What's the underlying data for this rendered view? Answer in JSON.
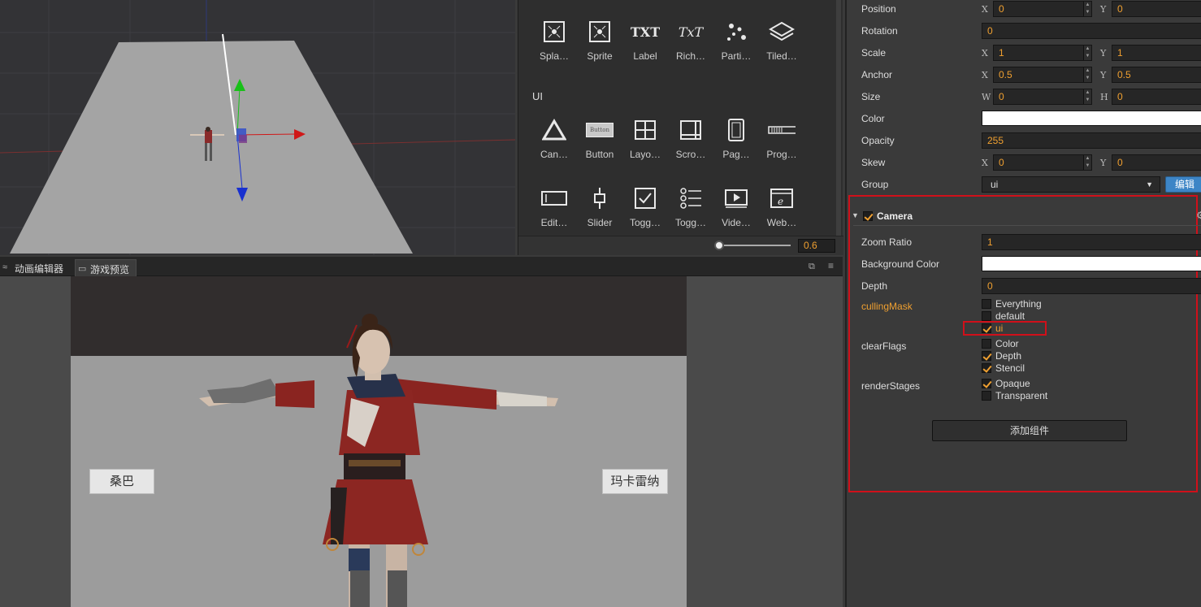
{
  "widgets": {
    "renderer_items": [
      {
        "label": "Spla…",
        "icon": "splash-icon"
      },
      {
        "label": "Sprite",
        "icon": "sprite-icon"
      },
      {
        "label": "Label",
        "icon": "label-icon",
        "glyph": "TXT"
      },
      {
        "label": "Rich…",
        "icon": "richtext-icon",
        "glyph": "TxT"
      },
      {
        "label": "Parti…",
        "icon": "particle-icon"
      },
      {
        "label": "Tiled…",
        "icon": "tiledmap-icon"
      }
    ],
    "ui_section_title": "UI",
    "ui_items_row1": [
      {
        "label": "Can…",
        "icon": "canvas-icon"
      },
      {
        "label": "Button",
        "icon": "button-icon",
        "glyph": "Button"
      },
      {
        "label": "Layo…",
        "icon": "layout-icon"
      },
      {
        "label": "Scro…",
        "icon": "scrollview-icon"
      },
      {
        "label": "Pag…",
        "icon": "pageview-icon"
      },
      {
        "label": "Prog…",
        "icon": "progressbar-icon"
      }
    ],
    "ui_items_row2": [
      {
        "label": "Edit…",
        "icon": "editbox-icon"
      },
      {
        "label": "Slider",
        "icon": "slider-icon"
      },
      {
        "label": "Togg…",
        "icon": "toggle-icon"
      },
      {
        "label": "Togg…",
        "icon": "togglegroup-icon"
      },
      {
        "label": "Vide…",
        "icon": "videoplayer-icon"
      },
      {
        "label": "Web…",
        "icon": "webview-icon"
      }
    ],
    "zoom_value": "0.6"
  },
  "tabs": [
    {
      "label": "动画编辑器",
      "icon": "animation-icon"
    },
    {
      "label": "游戏预览",
      "icon": "game-preview-icon"
    }
  ],
  "game": {
    "left_button": "桑巴",
    "right_button": "玛卡雷纳"
  },
  "inspector": {
    "position": {
      "label": "Position",
      "x_axis": "X",
      "x": "0",
      "y_axis": "Y",
      "y": "0"
    },
    "rotation": {
      "label": "Rotation",
      "value": "0"
    },
    "scale": {
      "label": "Scale",
      "x_axis": "X",
      "x": "1",
      "y_axis": "Y",
      "y": "1"
    },
    "anchor": {
      "label": "Anchor",
      "x_axis": "X",
      "x": "0.5",
      "y_axis": "Y",
      "y": "0.5"
    },
    "size": {
      "label": "Size",
      "w_axis": "W",
      "w": "0",
      "h_axis": "H",
      "h": "0"
    },
    "color": {
      "label": "Color",
      "value": "#ffffff"
    },
    "opacity": {
      "label": "Opacity",
      "value": "255"
    },
    "skew": {
      "label": "Skew",
      "x_axis": "X",
      "x": "0",
      "y_axis": "Y",
      "y": "0"
    },
    "group": {
      "label": "Group",
      "value": "ui",
      "edit_button": "编辑"
    },
    "camera": {
      "title": "Camera",
      "enabled": true,
      "zoom_ratio": {
        "label": "Zoom Ratio",
        "value": "1"
      },
      "background_color": {
        "label": "Background Color",
        "value": "#ffffff"
      },
      "depth": {
        "label": "Depth",
        "value": "0"
      },
      "culling_mask": {
        "label": "cullingMask",
        "options": [
          {
            "label": "Everything",
            "checked": false
          },
          {
            "label": "default",
            "checked": false
          },
          {
            "label": "ui",
            "checked": true
          }
        ]
      },
      "clear_flags": {
        "label": "clearFlags",
        "options": [
          {
            "label": "Color",
            "checked": false
          },
          {
            "label": "Depth",
            "checked": true
          },
          {
            "label": "Stencil",
            "checked": true
          }
        ]
      },
      "render_stages": {
        "label": "renderStages",
        "options": [
          {
            "label": "Opaque",
            "checked": true
          },
          {
            "label": "Transparent",
            "checked": false
          }
        ]
      }
    },
    "add_component_button": "添加组件"
  },
  "colors": {
    "accent": "#f0a030",
    "highlight": "#d0101a",
    "edit_button": "#3d85c6"
  }
}
